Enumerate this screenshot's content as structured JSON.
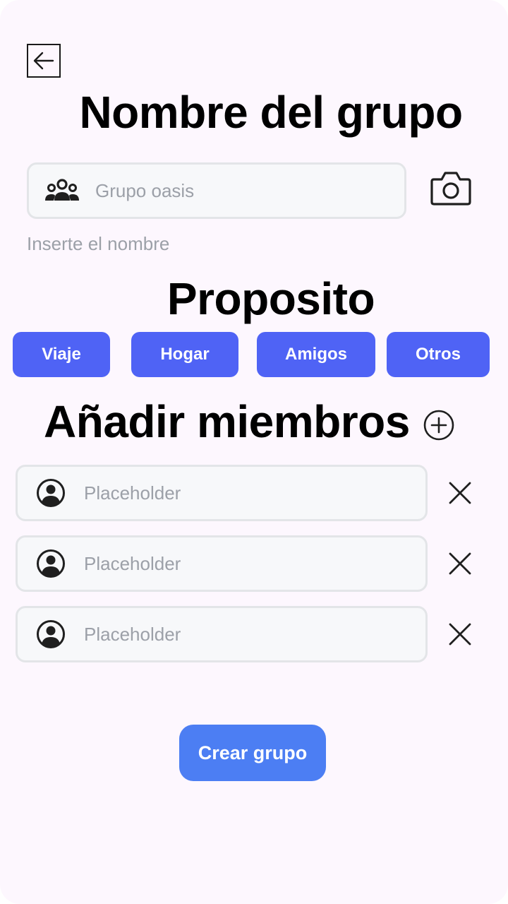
{
  "header": {
    "back_icon": "arrow-left-icon",
    "title": "Nombre del grupo"
  },
  "group_name": {
    "icon": "group-people-icon",
    "placeholder": "Grupo oasis",
    "value": "",
    "hint": "Inserte el nombre",
    "camera_icon": "camera-icon"
  },
  "purpose": {
    "title": "Proposito",
    "options": [
      {
        "label": "Viaje"
      },
      {
        "label": "Hogar"
      },
      {
        "label": "Amigos"
      },
      {
        "label": "Otros"
      }
    ],
    "chip_color": "#4f63f5"
  },
  "members": {
    "title": "Añadir miembros",
    "add_icon": "plus-circle-icon",
    "items": [
      {
        "placeholder": "Placeholder",
        "value": "",
        "icon": "user-avatar-icon",
        "remove_icon": "close-icon"
      },
      {
        "placeholder": "Placeholder",
        "value": "",
        "icon": "user-avatar-icon",
        "remove_icon": "close-icon"
      },
      {
        "placeholder": "Placeholder",
        "value": "",
        "icon": "user-avatar-icon",
        "remove_icon": "close-icon"
      }
    ]
  },
  "actions": {
    "create_label": "Crear grupo",
    "create_color": "#4c7ef3"
  }
}
